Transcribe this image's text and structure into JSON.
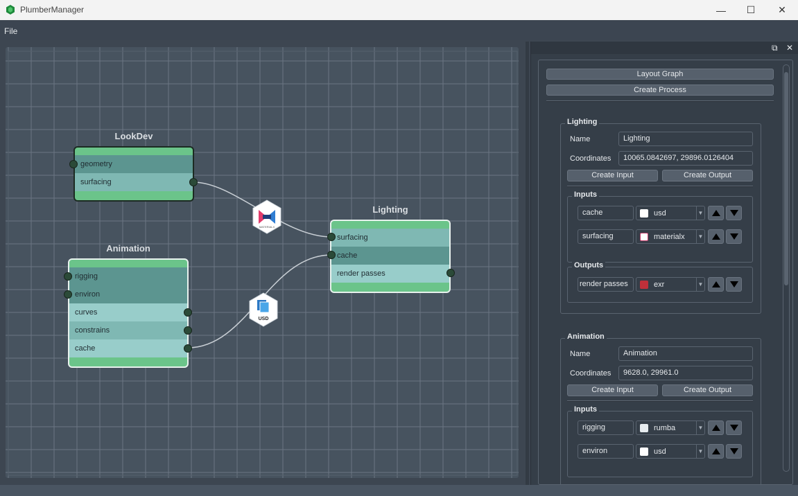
{
  "window": {
    "title": "PlumberManager",
    "minimize_glyph": "—",
    "maximize_glyph": "☐",
    "close_glyph": "✕"
  },
  "menu": {
    "file": "File"
  },
  "graph": {
    "nodes": {
      "lookdev": {
        "title": "LookDev",
        "rows": [
          "geometry",
          "surfacing"
        ]
      },
      "animation": {
        "title": "Animation",
        "rows": [
          "rigging",
          "environ",
          "curves",
          "constrains",
          "cache"
        ]
      },
      "lighting": {
        "title": "Lighting",
        "rows": [
          "surfacing",
          "cache",
          "render passes"
        ]
      }
    },
    "badges": {
      "materialx": "MATERIALX",
      "usd": "USD"
    }
  },
  "panel": {
    "float_glyph": "⧉",
    "close_glyph": "✕",
    "layout_graph": "Layout Graph",
    "create_process": "Create Process",
    "processes": [
      {
        "title": "Lighting",
        "name_label": "Name",
        "name": "Lighting",
        "coords_label": "Coordinates",
        "coords": "10065.0842697, 29896.0126404",
        "create_input": "Create Input",
        "create_output": "Create Output",
        "inputs_title": "Inputs",
        "inputs": [
          {
            "name": "cache",
            "type": "usd"
          },
          {
            "name": "surfacing",
            "type": "materialx"
          }
        ],
        "outputs_title": "Outputs",
        "outputs": [
          {
            "name": "render passes",
            "type": "exr"
          }
        ]
      },
      {
        "title": "Animation",
        "name_label": "Name",
        "name": "Animation",
        "coords_label": "Coordinates",
        "coords": "9628.0, 29961.0",
        "create_input": "Create Input",
        "create_output": "Create Output",
        "inputs_title": "Inputs",
        "inputs": [
          {
            "name": "rigging",
            "type": "rumba"
          },
          {
            "name": "environ",
            "type": "usd"
          }
        ]
      }
    ]
  },
  "colors": {
    "node_green": "#6bc48a",
    "row_dark": "#5c9590",
    "row_light": "#98cdca",
    "port": "#2b4a38",
    "canvas": "#47535f"
  }
}
